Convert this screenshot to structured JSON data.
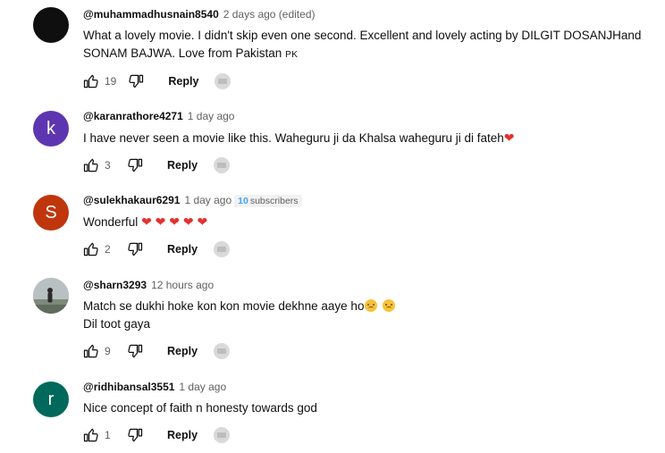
{
  "colors": {
    "avatar_k": "#5e35b1",
    "avatar_s": "#bf360c",
    "avatar_r": "#00695c",
    "avatar_m": "#0f0f0f"
  },
  "comments": [
    {
      "handle": "@muhammadhusnain8540",
      "time": "2 days ago (edited)",
      "text_line1": "What a lovely movie. I didn't skip even one second. Excellent and lovely acting by DILGIT DOSANJHand",
      "text_line2": "SONAM BAJWA. Love from Pakistan",
      "flag": "PK",
      "likes": "19",
      "reply_label": "Reply"
    },
    {
      "avatar_letter": "k",
      "handle": "@karanrathore4271",
      "time": "1 day ago",
      "text_line1": "I have never seen a movie like this. Waheguru ji da Khalsa waheguru ji di fateh",
      "likes": "3",
      "reply_label": "Reply"
    },
    {
      "avatar_letter": "S",
      "handle": "@sulekhakaur6291",
      "time": "1 day ago",
      "subs_count": "10",
      "subs_label": "subscribers",
      "text_line1": "Wonderful",
      "likes": "2",
      "reply_label": "Reply"
    },
    {
      "handle": "@sharn3293",
      "time": "12 hours ago",
      "text_line1": "Match se dukhi hoke kon kon movie dekhne aaye ho",
      "text_line2": "Dil toot gaya",
      "likes": "9",
      "reply_label": "Reply"
    },
    {
      "avatar_letter": "r",
      "handle": "@ridhibansal3551",
      "time": "1 day ago",
      "text_line1": "Nice concept of faith n honesty towards god",
      "likes": "1",
      "reply_label": "Reply"
    }
  ]
}
